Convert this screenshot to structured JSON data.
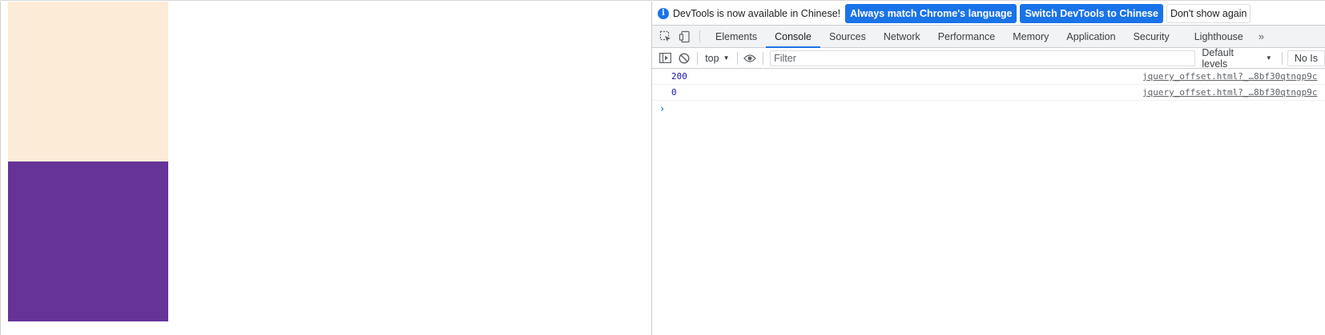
{
  "page": {
    "box_top_color": "#fbebd7",
    "box_bottom_color": "#663399"
  },
  "devtools": {
    "infobar": {
      "message": "DevTools is now available in Chinese!",
      "primary_button_1": "Always match Chrome's language",
      "primary_button_2": "Switch DevTools to Chinese",
      "secondary_button": "Don't show again"
    },
    "tabs": [
      {
        "label": "Elements"
      },
      {
        "label": "Console"
      },
      {
        "label": "Sources"
      },
      {
        "label": "Network"
      },
      {
        "label": "Performance"
      },
      {
        "label": "Memory"
      },
      {
        "label": "Application"
      },
      {
        "label": "Security"
      },
      {
        "label": "Lighthouse"
      }
    ],
    "active_tab": "Console",
    "toolbar": {
      "context": "top",
      "filter_placeholder": "Filter",
      "levels": "Default levels",
      "issues": "No Is"
    },
    "messages": [
      {
        "value": "200",
        "source": "jquery_offset.html?_…8bf30qtngp9c"
      },
      {
        "value": "0",
        "source": "jquery_offset.html?_…8bf30qtngp9c"
      }
    ],
    "accent_color": "#1a73e8"
  }
}
